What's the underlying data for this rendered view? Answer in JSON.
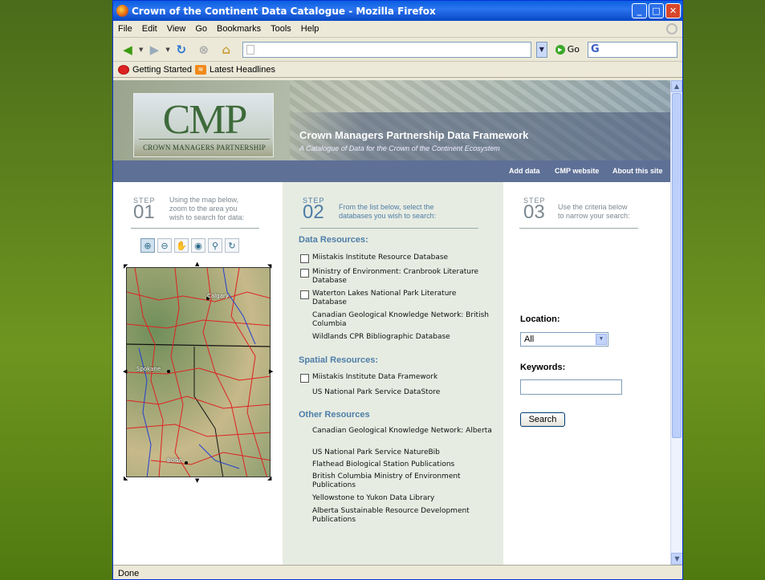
{
  "window": {
    "title": "Crown of the Continent Data Catalogue - Mozilla Firefox"
  },
  "menu": [
    "File",
    "Edit",
    "View",
    "Go",
    "Bookmarks",
    "Tools",
    "Help"
  ],
  "navbar": {
    "url": "",
    "go_label": "Go",
    "search_logo": "G"
  },
  "bookmarks": [
    "Getting Started",
    "Latest Headlines"
  ],
  "header": {
    "logo_text": "CMP",
    "logo_sub": "CROWN MANAGERS PARTNERSHIP",
    "title": "Crown Managers Partnership Data Framework",
    "subtitle": "A Catalogue of Data for the Crown of the Continent Ecosystem",
    "nav": [
      "Add data",
      "CMP website",
      "About this site"
    ]
  },
  "step1": {
    "label": "STEP",
    "num": "01",
    "text": [
      "Using the map below,",
      "zoom to the area you",
      "wish to search for data:"
    ]
  },
  "map": {
    "labels": [
      "Calgary",
      "Spokane",
      "Boise"
    ]
  },
  "step2": {
    "label": "STEP",
    "num": "02",
    "text": [
      "From the list below, select the",
      "databases you wish to search:"
    ],
    "sections": [
      {
        "title": "Data Resources:",
        "items": [
          {
            "label": "Miistakis Institute Resource Database",
            "checkbox": true
          },
          {
            "label": "Ministry of Environment: Cranbrook Literature Database",
            "checkbox": true
          },
          {
            "label": "Waterton Lakes National Park Literature Database",
            "checkbox": true
          },
          {
            "label": "Canadian Geological Knowledge Network: British Columbia",
            "checkbox": false
          },
          {
            "label": "Wildlands CPR Bibliographic Database",
            "checkbox": false
          }
        ]
      },
      {
        "title": "Spatial Resources:",
        "items": [
          {
            "label": "Miistakis Institute Data Framework",
            "checkbox": true
          },
          {
            "label": "US National Park Service DataStore",
            "checkbox": false
          }
        ]
      },
      {
        "title": "Other Resources",
        "items": [
          {
            "label": "Canadian Geological Knowledge Network: Alberta",
            "checkbox": false
          },
          {
            "label": "US National Park Service NatureBib",
            "checkbox": false
          },
          {
            "label": "Flathead Biological Station Publications",
            "checkbox": false
          },
          {
            "label": "British Columbia Ministry of Environment Publications",
            "checkbox": false
          },
          {
            "label": "Yellowstone to Yukon Data Library",
            "checkbox": false
          },
          {
            "label": "Alberta Sustainable Resource Development Publications",
            "checkbox": false
          }
        ]
      }
    ]
  },
  "step3": {
    "label": "STEP",
    "num": "03",
    "text": [
      "Use the criteria below",
      "to narrow your search:"
    ],
    "location_label": "Location:",
    "location_value": "All",
    "keywords_label": "Keywords:",
    "keywords_value": "",
    "search_button": "Search"
  },
  "status": "Done"
}
